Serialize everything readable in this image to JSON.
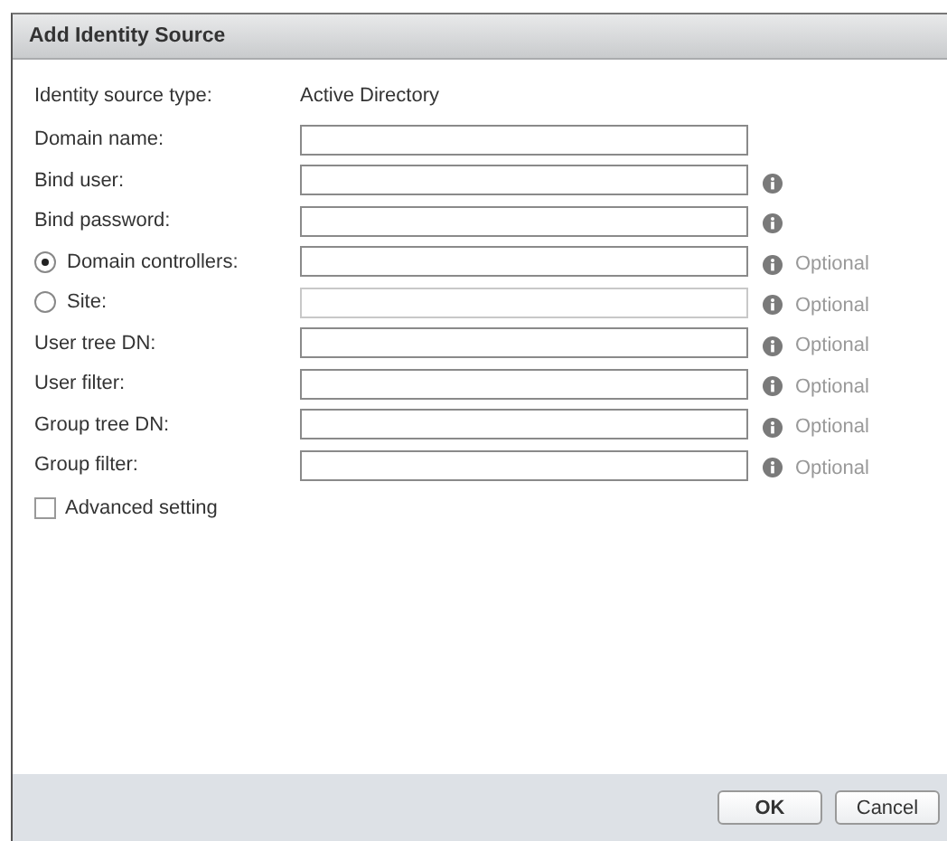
{
  "window": {
    "title": "Add Identity Source"
  },
  "rows": [
    {
      "kind": "text",
      "label": "Identity source type:",
      "value": "Active Directory"
    },
    {
      "kind": "field",
      "label": "Domain name:",
      "info": false,
      "disabled": false
    },
    {
      "kind": "field",
      "label": "Bind user:",
      "info": true,
      "disabled": false
    },
    {
      "kind": "field",
      "label": "Bind password:",
      "info": true,
      "disabled": false
    },
    {
      "kind": "radio",
      "label": "Domain controllers:",
      "selected": true,
      "info": true,
      "disabled": false,
      "note": "Optional"
    },
    {
      "kind": "radio",
      "label": "Site:",
      "selected": false,
      "info": true,
      "disabled": true,
      "note": "Optional"
    },
    {
      "kind": "field",
      "label": "User tree DN:",
      "info": true,
      "disabled": false,
      "note": "Optional"
    },
    {
      "kind": "field",
      "label": "User filter:",
      "info": true,
      "disabled": false,
      "note": "Optional"
    },
    {
      "kind": "field",
      "label": "Group tree DN:",
      "info": true,
      "disabled": false,
      "note": "Optional"
    },
    {
      "kind": "field",
      "label": "Group filter:",
      "info": true,
      "disabled": false,
      "note": "Optional"
    }
  ],
  "advanced": {
    "label": "Advanced setting",
    "checked": false
  },
  "buttons": [
    {
      "label": "OK",
      "kind": "primary"
    },
    {
      "label": "Cancel",
      "kind": "secondary"
    }
  ]
}
